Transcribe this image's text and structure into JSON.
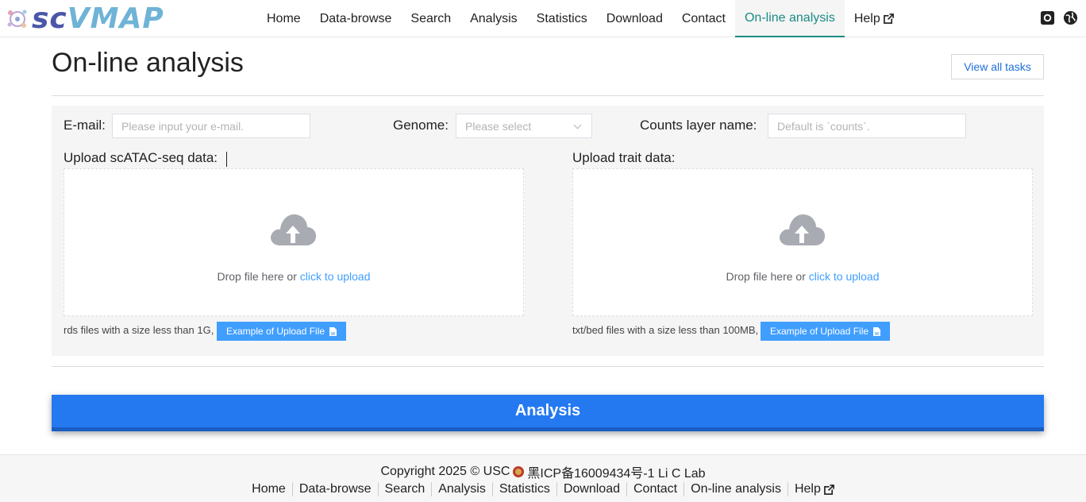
{
  "brand": {
    "logo_sc": "sc",
    "logo_vmap": "VMAP"
  },
  "nav": {
    "items": [
      {
        "label": "Home"
      },
      {
        "label": "Data-browse"
      },
      {
        "label": "Search"
      },
      {
        "label": "Analysis"
      },
      {
        "label": "Statistics"
      },
      {
        "label": "Download"
      },
      {
        "label": "Contact"
      },
      {
        "label": "On-line analysis"
      },
      {
        "label": "Help"
      }
    ],
    "active": "On-line analysis",
    "icons": [
      "github-icon",
      "globe-icon"
    ]
  },
  "page": {
    "title": "On-line analysis",
    "view_tasks": "View all tasks"
  },
  "form": {
    "email_label": "E-mail:",
    "email_placeholder": "Please input your e-mail.",
    "genome_label": "Genome:",
    "genome_placeholder": "Please select",
    "counts_label": "Counts layer name:",
    "counts_placeholder": "Default is `counts`.",
    "upload_atac_label": "Upload scATAC-seq data:",
    "upload_trait_label": "Upload trait data:",
    "drop_text": "Drop file here or ",
    "drop_link": "click to upload",
    "atac_hint": "rds files with a size less than 1G,",
    "trait_hint": "txt/bed files with a size less than 100MB,",
    "example_label": "Example of Upload File",
    "analysis_button": "Analysis"
  },
  "footer": {
    "copyright_pre": "Copyright 2025 © USC",
    "copyright_post": "黑ICP备16009434号-1 Li C Lab",
    "links": [
      "Home",
      "Data-browse",
      "Search",
      "Analysis",
      "Statistics",
      "Download",
      "Contact",
      "On-line analysis",
      "Help"
    ]
  },
  "colors": {
    "accent": "#1b8a84",
    "primary": "#2479f1",
    "link": "#409eff"
  }
}
